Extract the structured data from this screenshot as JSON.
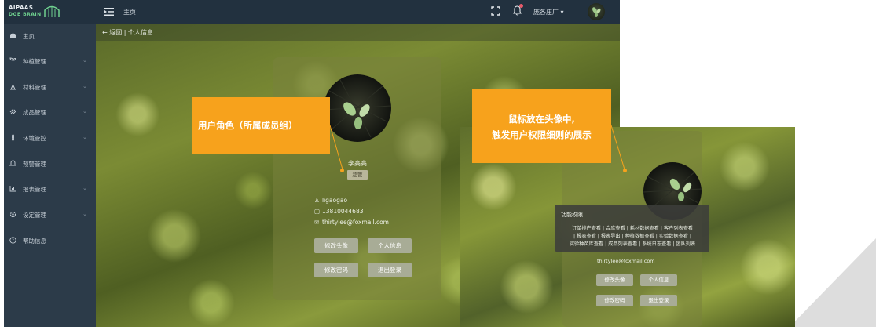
{
  "app": {
    "logo_line1": "AIPAAS",
    "logo_line2": "DGE BRAIN",
    "breadcrumb_home": "主页",
    "username": "庞各庄厂",
    "username_caret": "▾"
  },
  "sidebar": {
    "items": [
      {
        "label": "主页",
        "icon": "home-icon",
        "has_children": false
      },
      {
        "label": "种植管理",
        "icon": "sprout-icon",
        "has_children": true
      },
      {
        "label": "材料管理",
        "icon": "material-icon",
        "has_children": true
      },
      {
        "label": "成品管理",
        "icon": "product-icon",
        "has_children": true
      },
      {
        "label": "环境管控",
        "icon": "thermometer-icon",
        "has_children": true
      },
      {
        "label": "预警管理",
        "icon": "bell-icon",
        "has_children": false
      },
      {
        "label": "报表管理",
        "icon": "chart-icon",
        "has_children": true
      },
      {
        "label": "设定管理",
        "icon": "gear-icon",
        "has_children": true
      },
      {
        "label": "帮助信息",
        "icon": "help-icon",
        "has_children": false
      }
    ]
  },
  "subbar": {
    "back_label": "← 返回",
    "separator": "|",
    "page_title": "个人信息"
  },
  "profile": {
    "name": "李高高",
    "role": "超管",
    "account": "ligaogao",
    "phone": "13810044683",
    "email": "thirtylee@foxmail.com"
  },
  "buttons": {
    "change_avatar": "修改头像",
    "personal_info": "个人信息",
    "change_password": "修改密码",
    "logout": "退出登录"
  },
  "callouts": {
    "role_note": "用户角色（所属成员组）",
    "hover_note_line1": "鼠标放在头像中,",
    "hover_note_line2": "触发用户权限细则的展示"
  },
  "tooltip": {
    "title": "功能权限",
    "line1": "订单排产查看 | 合库查看 | 耗材数据查看 | 客户列表查看",
    "line2": "| 报表查看 | 报表导出 | 种植数据查看 | 实验数据查看 |",
    "line3": "实验种苗库查看 | 成品列表查看 | 系统日志查看 | 团队列表"
  },
  "panel2": {
    "email": "thirtylee@foxmail.com"
  },
  "colors": {
    "sidebar_bg": "#2c3b49",
    "topbar_bg": "#22313f",
    "callout_orange": "#f7a21c",
    "button_gray": "#a8ac96"
  }
}
